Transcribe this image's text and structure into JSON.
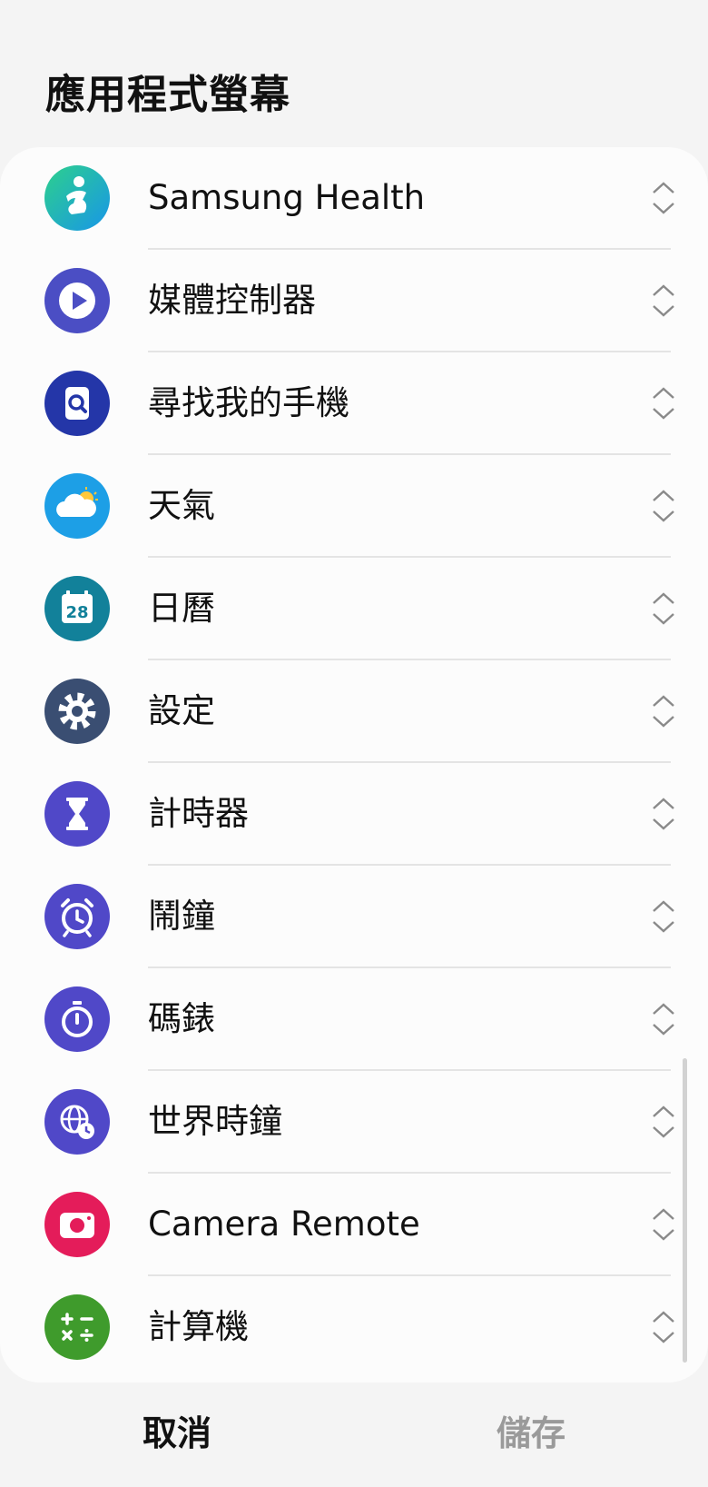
{
  "header": {
    "title": "應用程式螢幕"
  },
  "apps": [
    {
      "label": "Samsung Health",
      "icon": "samsung-health-icon",
      "color": "#1fb8a0"
    },
    {
      "label": "媒體控制器",
      "icon": "play-icon",
      "color": "#4b4ec4"
    },
    {
      "label": "尋找我的手機",
      "icon": "find-phone-icon",
      "color": "#2436a8"
    },
    {
      "label": "天氣",
      "icon": "weather-icon",
      "color": "#1d9fe6"
    },
    {
      "label": "日曆",
      "icon": "calendar-icon",
      "color": "#12819a",
      "badge": "28"
    },
    {
      "label": "設定",
      "icon": "gear-icon",
      "color": "#3a4e72"
    },
    {
      "label": "計時器",
      "icon": "hourglass-icon",
      "color": "#5048c8"
    },
    {
      "label": "鬧鐘",
      "icon": "alarm-clock-icon",
      "color": "#5048c8"
    },
    {
      "label": "碼錶",
      "icon": "stopwatch-icon",
      "color": "#5048c8"
    },
    {
      "label": "世界時鐘",
      "icon": "world-clock-icon",
      "color": "#5048c8"
    },
    {
      "label": "Camera Remote",
      "icon": "camera-icon",
      "color": "#e41c5a"
    },
    {
      "label": "計算機",
      "icon": "calculator-icon",
      "color": "#3f9b2c"
    }
  ],
  "footer": {
    "cancel_label": "取消",
    "save_label": "儲存"
  },
  "colors": {
    "background": "#f4f4f4",
    "card": "#fcfcfc",
    "disabled_text": "#9a9a9a"
  }
}
